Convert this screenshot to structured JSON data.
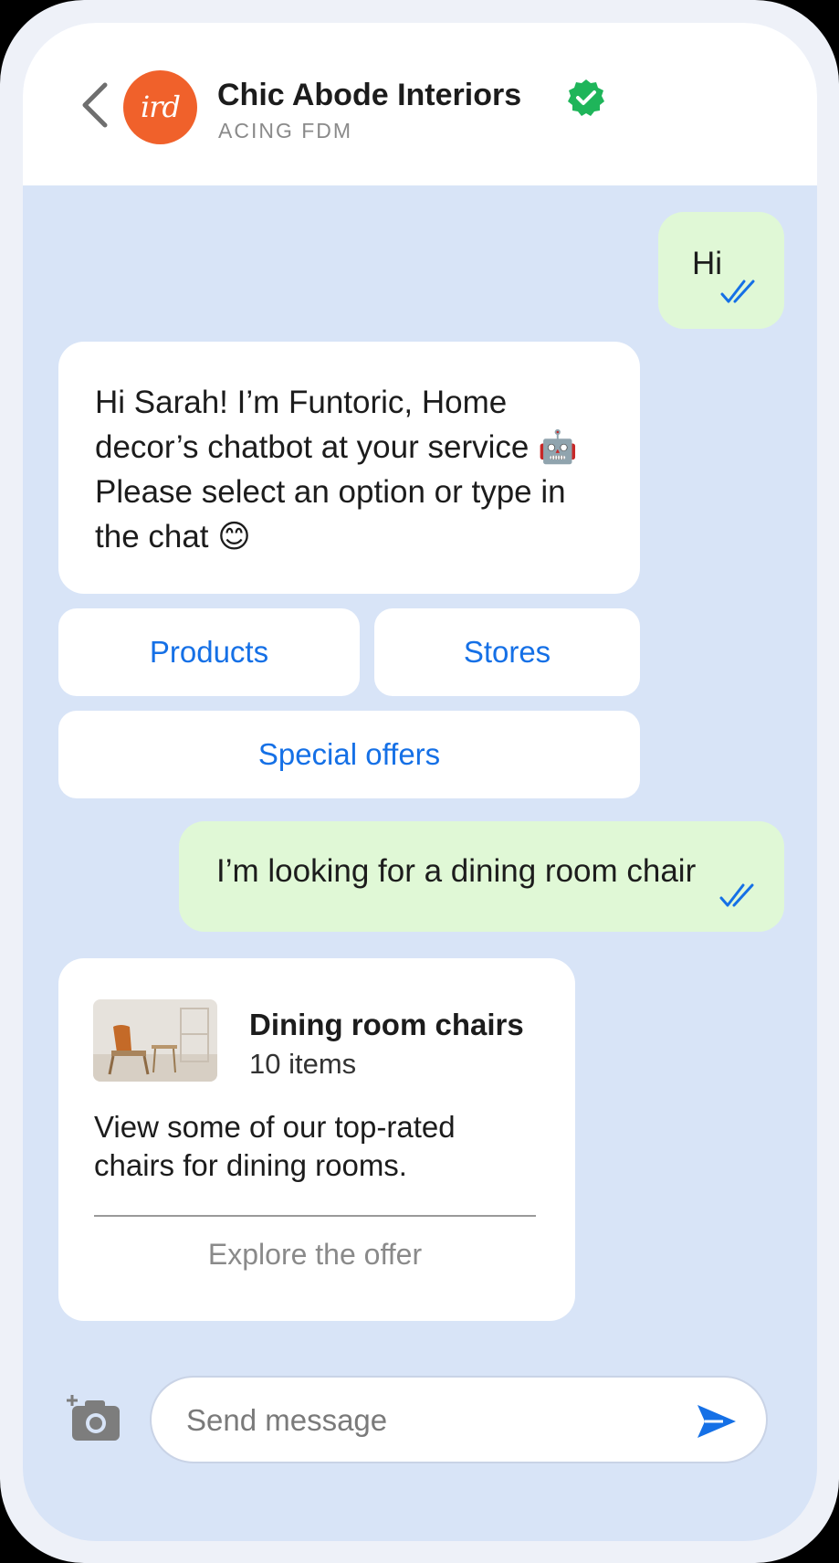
{
  "header": {
    "avatar_text": "ird",
    "title": "Chic Abode Interiors",
    "subtitle": "ACING FDM",
    "icons": {
      "back": "chevron-left-icon",
      "verified": "verified-check-icon"
    }
  },
  "messages": {
    "greeting_out": "Hi",
    "bot_intro": "Hi Sarah! I’m Funtoric, Home decor’s chatbot at your service 🤖 Please select an option or type in the chat 😊",
    "chair_request": "I’m looking for a dining room chair"
  },
  "quick_replies": {
    "products": "Products",
    "stores": "Stores",
    "special_offers": "Special offers"
  },
  "card": {
    "title": "Dining room chairs",
    "count": "10 items",
    "description": "View some of our top-rated chairs for dining rooms.",
    "link": "Explore the offer"
  },
  "composer": {
    "placeholder": "Send message",
    "icons": {
      "camera": "add-photo-camera-icon",
      "send": "send-icon"
    }
  },
  "colors": {
    "accent": "#1570e6",
    "brand": "#f0612b",
    "outgoing_bubble": "#e0f8d6",
    "chat_background": "#d8e4f7",
    "verified": "#1fb55a"
  }
}
